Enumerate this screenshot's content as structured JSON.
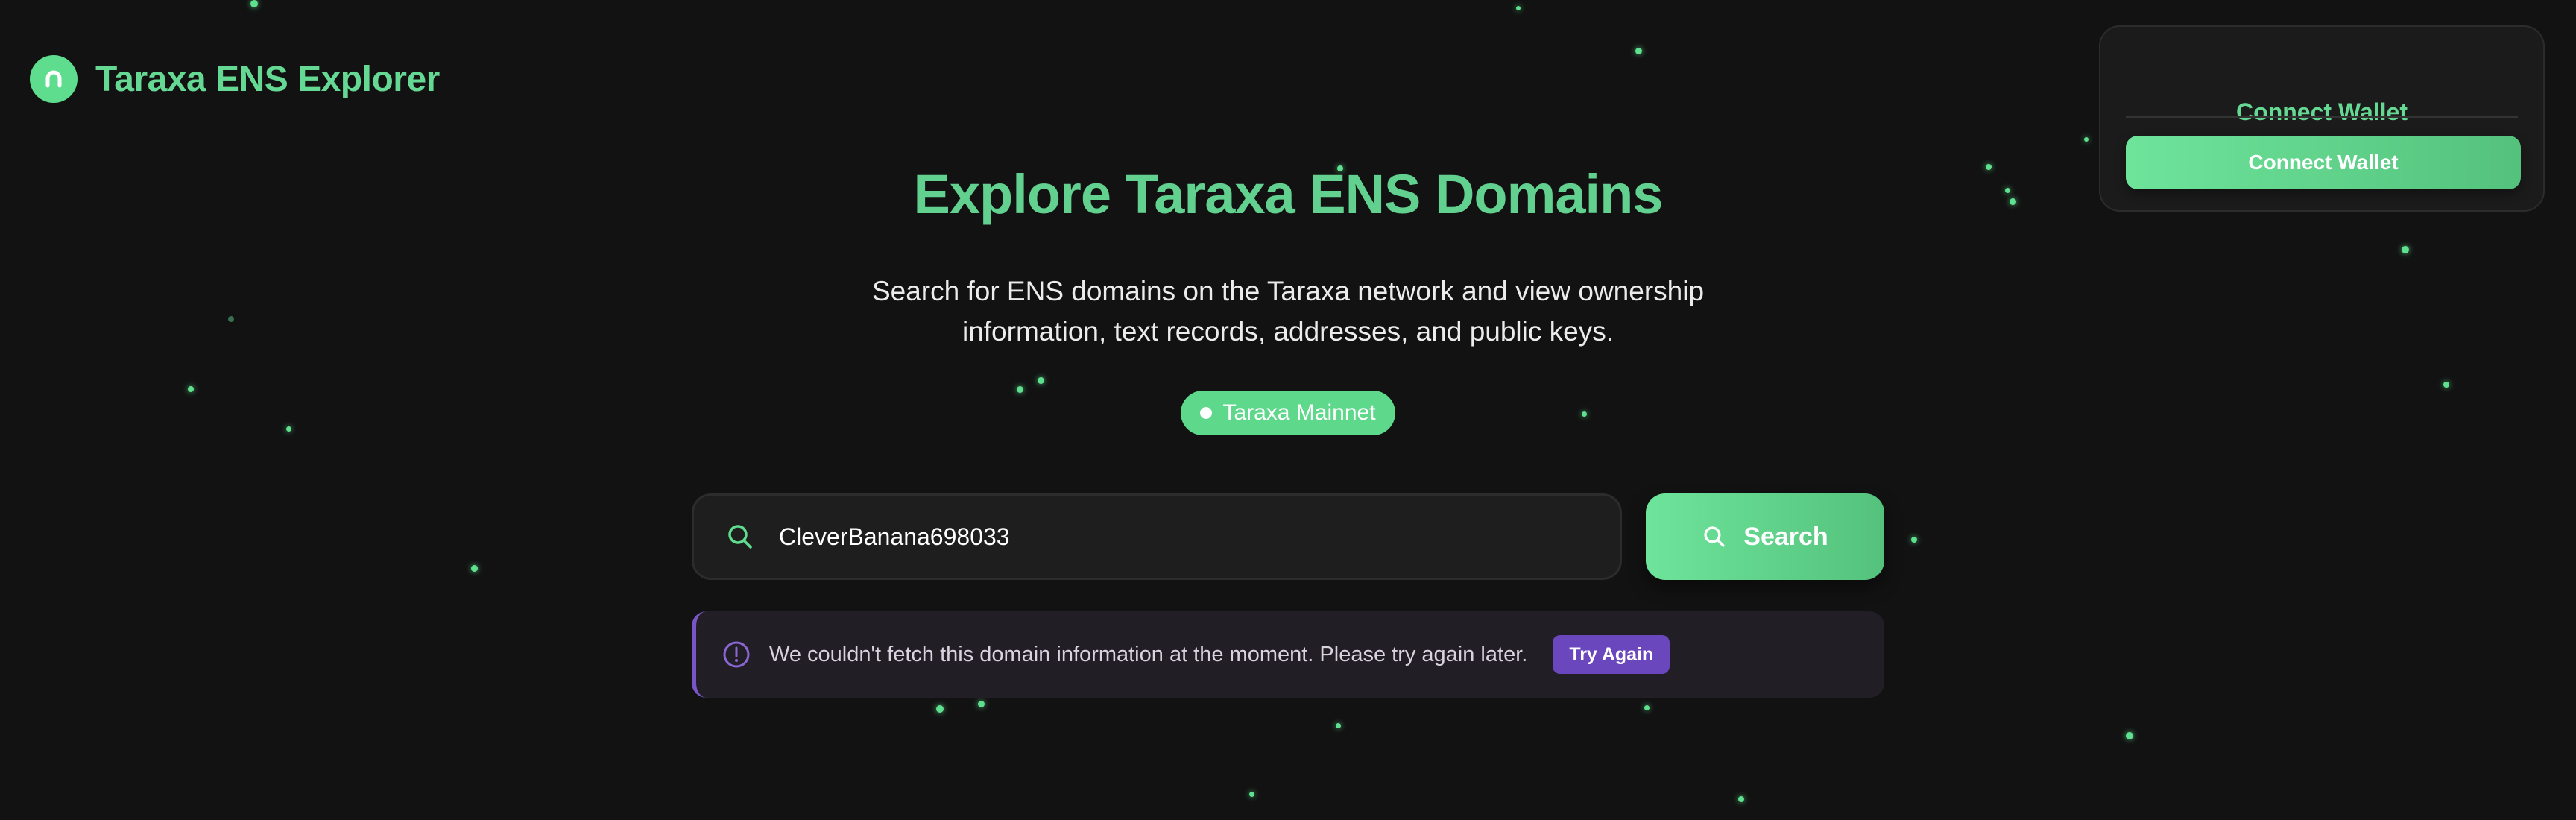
{
  "app": {
    "title": "Taraxa ENS Explorer",
    "logo_icon": "arch-icon"
  },
  "wallet": {
    "title": "Connect Wallet",
    "button_label": "Connect Wallet"
  },
  "hero": {
    "title": "Explore Taraxa ENS Domains",
    "subtitle_line1": "Search for ENS domains on the Taraxa network and view ownership",
    "subtitle_line2": "information, text records, addresses, and public keys.",
    "network_badge": "Taraxa Mainnet"
  },
  "search": {
    "value": "CleverBanana698033",
    "icon": "search-icon",
    "button_label": "Search"
  },
  "error": {
    "icon": "alert-circle-icon",
    "message": "We couldn't fetch this domain information at the moment. Please try again later.",
    "retry_label": "Try Again"
  },
  "colors": {
    "background": "#121212",
    "accent_green": "#5fdd8e",
    "error_purple": "#7a55c8"
  }
}
